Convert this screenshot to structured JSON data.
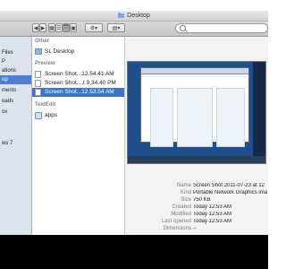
{
  "window": {
    "title": "Desktop"
  },
  "sidebar": {
    "items": [
      {
        "label": "Files",
        "selected": false
      },
      {
        "label": "P",
        "selected": false
      },
      {
        "label": "ations",
        "selected": false
      },
      {
        "label": "op",
        "selected": true
      },
      {
        "label": "ments",
        "selected": false
      },
      {
        "label": "oads",
        "selected": false
      },
      {
        "label": "ox",
        "selected": false
      },
      {
        "label": "ws 7",
        "selected": false
      }
    ]
  },
  "column": {
    "sections": {
      "other": "Other",
      "preview": "Preview",
      "textedit": "TextEdit"
    },
    "other_items": [
      "SL Desktop"
    ],
    "preview_items": [
      "Screen Shot...12.54.41 AM",
      "Screen Shot....t 9.34.40 PM",
      "Screen Shot...12.53.54 AM"
    ],
    "textedit_items": [
      "apps"
    ],
    "selected_index": 2
  },
  "metadata": [
    {
      "label": "Name",
      "value": "Screen Shot 2011-07-23 at 12"
    },
    {
      "label": "Kind",
      "value": "Portable Network Graphics ima"
    },
    {
      "label": "Size",
      "value": "750 KB"
    },
    {
      "label": "Created",
      "value": "Today 12:53 AM"
    },
    {
      "label": "Modified",
      "value": "Today 12:53 AM"
    },
    {
      "label": "Last opened",
      "value": "Today 12:53 AM"
    },
    {
      "label": "Dimensions",
      "value": "--"
    }
  ],
  "colors": {
    "selection": "#3a76c6",
    "sidebar_bg": "#dde3ea",
    "toolbar": "#cfcfcf"
  }
}
